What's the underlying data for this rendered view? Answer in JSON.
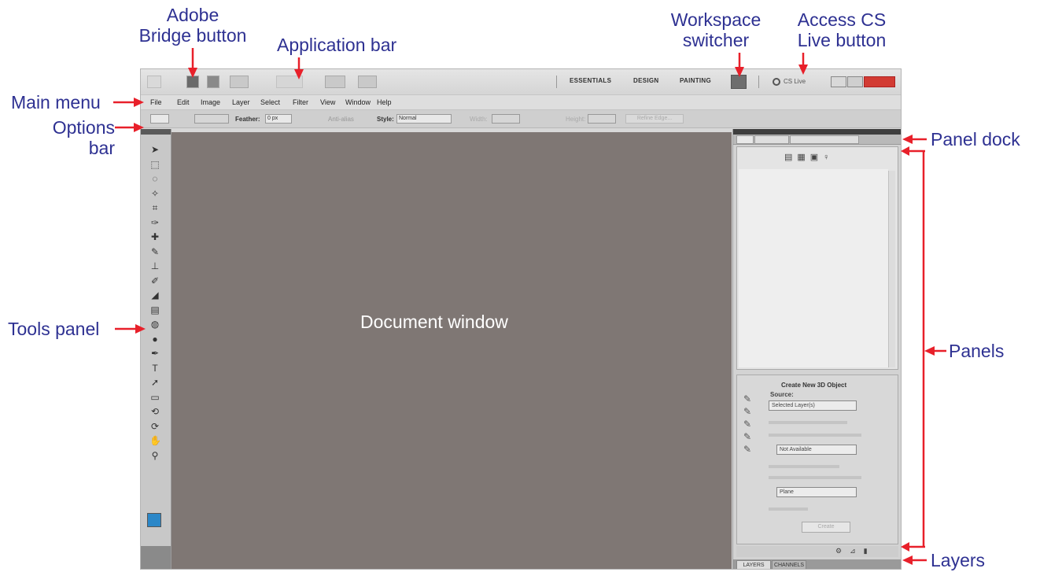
{
  "callouts": {
    "adobe_bridge": [
      "Adobe",
      "Bridge button"
    ],
    "application_bar": "Application bar",
    "workspace_switcher": [
      "Workspace",
      "switcher"
    ],
    "access_cs_live": [
      "Access CS",
      "Live button"
    ],
    "main_menu": "Main menu",
    "options_bar": [
      "Options",
      "bar"
    ],
    "panel_dock": "Panel dock",
    "tools_panel": "Tools panel",
    "panels": "Panels",
    "layers": "Layers",
    "document_window": "Document window"
  },
  "colors": {
    "callout_text": "#2e3192",
    "arrow": "#e8202a",
    "document_window": "#7f7774",
    "foreground_swatch": "#2b87c8"
  },
  "application_bar": {
    "workspaces": [
      "ESSENTIALS",
      "DESIGN",
      "PAINTING"
    ],
    "cs_live": "CS Live"
  },
  "main_menu": [
    "File",
    "Edit",
    "Image",
    "Layer",
    "Select",
    "Filter",
    "View",
    "Window",
    "Help"
  ],
  "options_bar": {
    "feather_label": "Feather:",
    "feather_value": "0 px",
    "antialias_label": "Anti-alias",
    "style_label": "Style:",
    "style_value": "Normal",
    "width_label": "Width:",
    "height_label": "Height:",
    "refine_edge": "Refine Edge..."
  },
  "panel_3d": {
    "title": "Create New 3D Object",
    "source_label": "Source:",
    "source_value": "Selected Layer(s)",
    "option_value": "Not Available",
    "shape_value": "Plane",
    "create_button": "Create"
  },
  "layers_tabs": [
    "LAYERS",
    "CHANNELS"
  ],
  "tool_icons": [
    "move-icon",
    "marquee-icon",
    "lasso-icon",
    "quick-selection-icon",
    "crop-icon",
    "eyedropper-icon",
    "healing-brush-icon",
    "brush-icon",
    "clone-stamp-icon",
    "history-brush-icon",
    "eraser-icon",
    "gradient-icon",
    "blur-icon",
    "dodge-icon",
    "pen-icon",
    "type-icon",
    "path-selection-icon",
    "shape-icon",
    "3d-rotate-icon",
    "3d-orbit-icon",
    "hand-icon",
    "zoom-icon"
  ]
}
